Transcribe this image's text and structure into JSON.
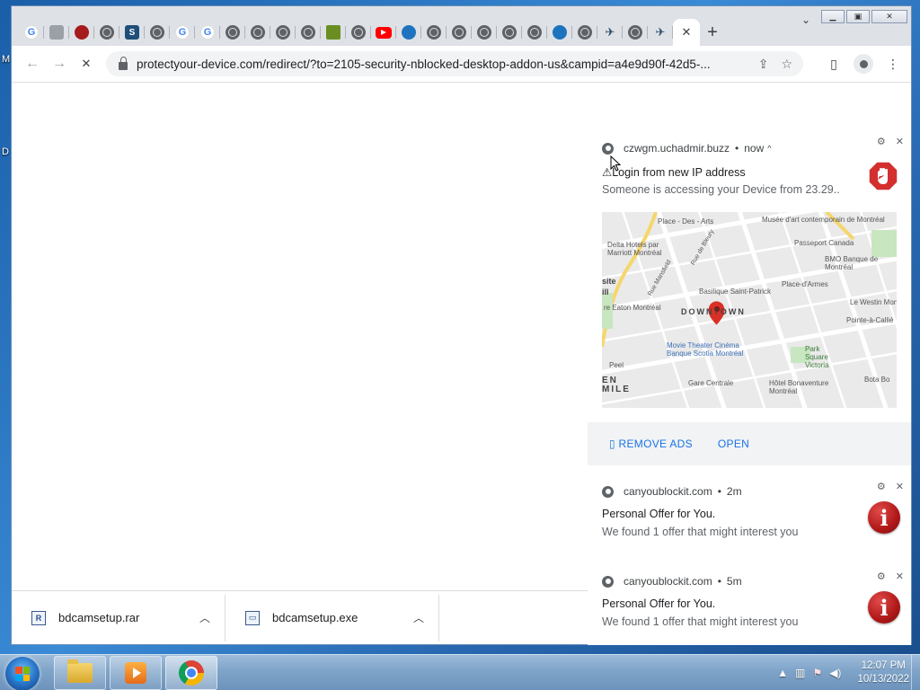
{
  "desktop": {
    "letter_m": "M",
    "letter_d": "D"
  },
  "browser": {
    "tabs": [
      {
        "icon": "google-icon",
        "glyph": "G",
        "kind": "g"
      },
      {
        "icon": "shield-icon",
        "glyph": "",
        "kind": "grey"
      },
      {
        "icon": "red-site-icon",
        "glyph": "",
        "kind": "red"
      },
      {
        "icon": "globe-icon",
        "glyph": "",
        "kind": "globe"
      },
      {
        "icon": "s-site-icon",
        "glyph": "S",
        "kind": "s"
      },
      {
        "icon": "globe-icon",
        "glyph": "",
        "kind": "globe"
      },
      {
        "icon": "google-icon",
        "glyph": "G",
        "kind": "g"
      },
      {
        "icon": "google-icon",
        "glyph": "G",
        "kind": "g"
      },
      {
        "icon": "globe-icon",
        "glyph": "",
        "kind": "globe"
      },
      {
        "icon": "globe-icon",
        "glyph": "",
        "kind": "globe"
      },
      {
        "icon": "globe-icon",
        "glyph": "",
        "kind": "globe"
      },
      {
        "icon": "globe-icon",
        "glyph": "",
        "kind": "globe"
      },
      {
        "icon": "news-icon",
        "glyph": "",
        "kind": "news"
      },
      {
        "icon": "globe-icon",
        "glyph": "",
        "kind": "globe"
      },
      {
        "icon": "youtube-icon",
        "glyph": "",
        "kind": "yt"
      },
      {
        "icon": "blue-swirl-icon",
        "glyph": "",
        "kind": "blue"
      },
      {
        "icon": "globe-icon",
        "glyph": "",
        "kind": "globe"
      },
      {
        "icon": "globe-icon",
        "glyph": "",
        "kind": "globe"
      },
      {
        "icon": "globe-icon",
        "glyph": "",
        "kind": "globe"
      },
      {
        "icon": "globe-icon",
        "glyph": "",
        "kind": "globe"
      },
      {
        "icon": "globe-icon",
        "glyph": "",
        "kind": "globe"
      },
      {
        "icon": "blue-swirl-icon",
        "glyph": "",
        "kind": "blue"
      },
      {
        "icon": "globe-icon",
        "glyph": "",
        "kind": "globe"
      },
      {
        "icon": "bird-icon",
        "glyph": "✈",
        "kind": "bird"
      },
      {
        "icon": "globe-icon",
        "glyph": "",
        "kind": "globe"
      },
      {
        "icon": "bird-icon",
        "glyph": "✈",
        "kind": "bird"
      }
    ],
    "active_tab_close": "✕",
    "new_tab": "+",
    "tab_menu": "⌄",
    "url": "protectyour-device.com/redirect/?to=2105-security-nblocked-desktop-addon-us&campid=a4e9d90f-42d5-...",
    "downloads": [
      {
        "name": "bdcamsetup.rar",
        "icon_glyph": "R"
      },
      {
        "name": "bdcamsetup.exe",
        "icon_glyph": "▭"
      }
    ]
  },
  "notifications": [
    {
      "site": "czwgm.uchadmir.buzz",
      "time": "now",
      "title": "⚠Login from new IP address",
      "message": "Someone is accessing your Device from 23.29..",
      "buttons": [
        "▯ REMOVE ADS",
        "OPEN"
      ],
      "map": {
        "labels": [
          "Place - Des - Arts",
          "Musée d'art contemporain de Montréal",
          "Delta Hotels par Marriott Montréal",
          "Passeport Canada",
          "BMO Banque de Montréal",
          "Basilique Saint-Patrick",
          "Place-d'Armes",
          "Le Westin Mon",
          "site",
          "ill",
          "re Eaton Montréal",
          "DOWNTOWN",
          "Pointe-à-Callié",
          "Movie Theater Cinéma Banque Scotia Montréal",
          "Park Square Victoria",
          "Peel",
          "EN",
          "MILE",
          "Gare Centrale",
          "Hôtel Bonaventure Montréal",
          "Bota Bo",
          "Rue de Bleury",
          "Rue Mansfield"
        ]
      }
    },
    {
      "site": "canyoublockit.com",
      "time": "2m",
      "title": "Personal Offer for You.",
      "message": "We found 1 offer that might interest you"
    },
    {
      "site": "canyoublockit.com",
      "time": "5m",
      "title": "Personal Offer for You.",
      "message": "We found 1 offer that might interest you"
    }
  ],
  "taskbar": {
    "time": "12:07 PM",
    "date": "10/13/2022"
  }
}
